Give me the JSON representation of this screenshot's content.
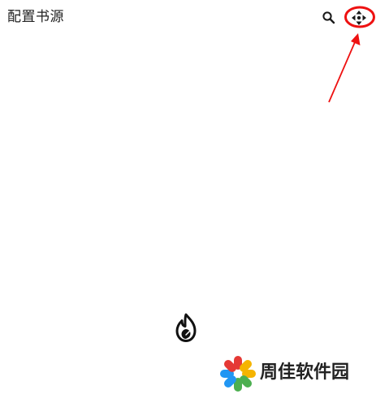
{
  "appbar": {
    "title": "配置书源",
    "search_icon": "search-icon",
    "source_icon": "move-icon"
  },
  "annotation": {
    "color": "#ee1111",
    "target": "move-icon"
  },
  "empty_state": {
    "icon": "flame-icon"
  },
  "watermark": {
    "text": "周佳软件园",
    "colors": [
      "#e53935",
      "#f5b400",
      "#2196f3",
      "#4caf50"
    ]
  }
}
